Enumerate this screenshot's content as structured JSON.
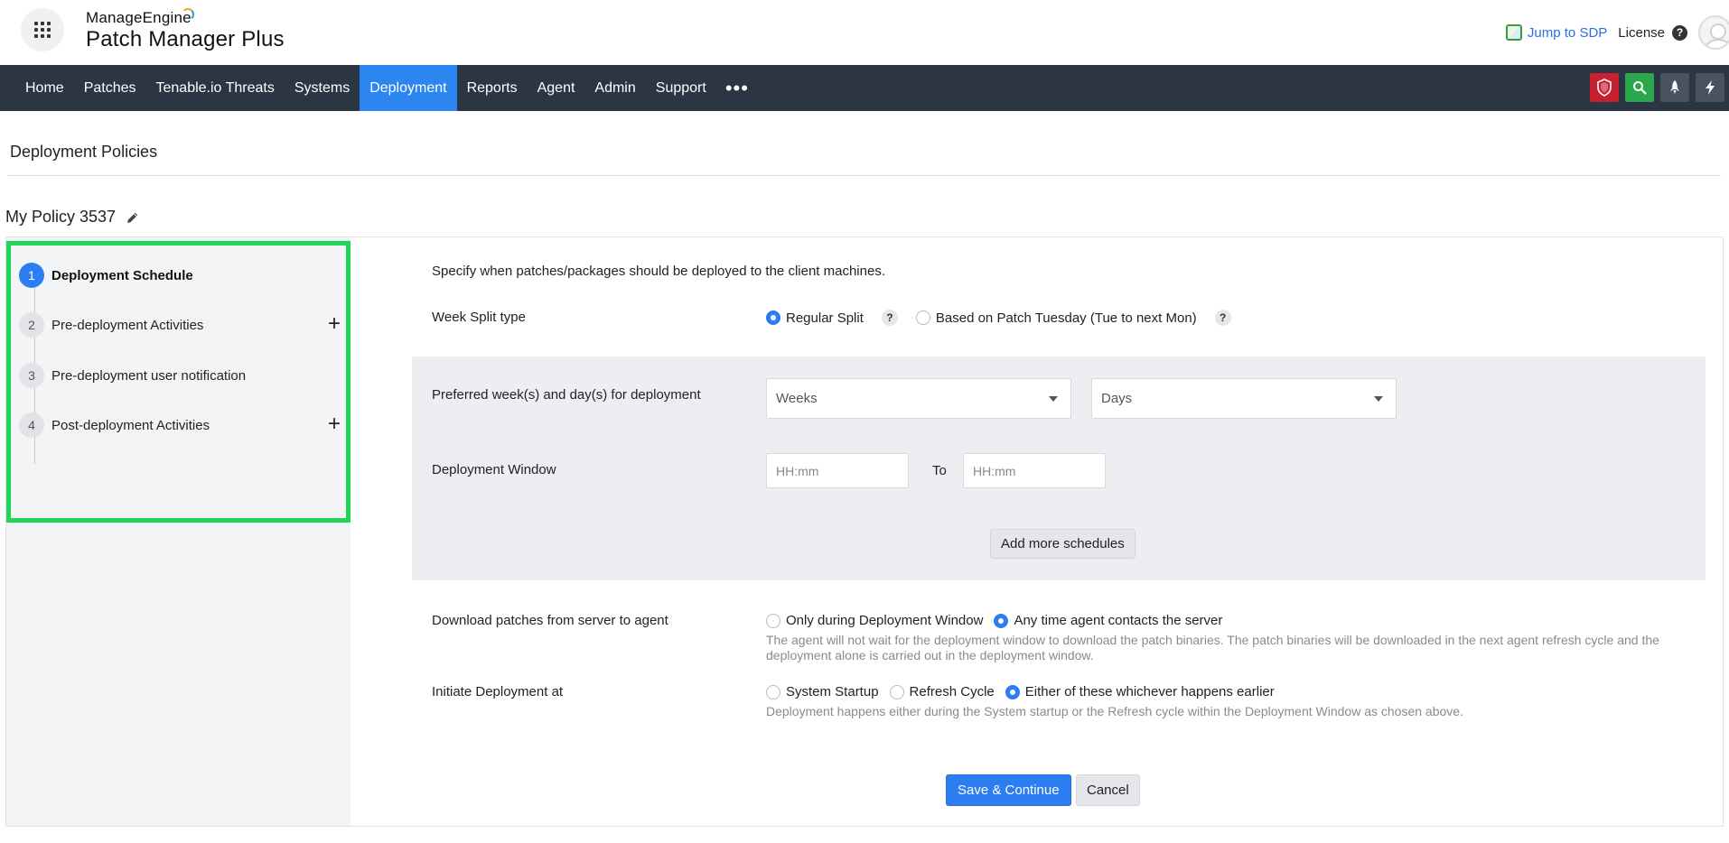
{
  "header": {
    "brand_small": "ManageEngine",
    "brand_product": "Patch Manager Plus",
    "jump_label": "Jump to SDP",
    "license_label": "License",
    "help_glyph": "?"
  },
  "nav": {
    "items": [
      {
        "label": "Home"
      },
      {
        "label": "Patches"
      },
      {
        "label": "Tenable.io Threats"
      },
      {
        "label": "Systems"
      },
      {
        "label": "Deployment",
        "active": true
      },
      {
        "label": "Reports"
      },
      {
        "label": "Agent"
      },
      {
        "label": "Admin"
      },
      {
        "label": "Support"
      }
    ],
    "more_glyph": "•••",
    "tools": [
      "shield-icon",
      "search-icon",
      "rocket-icon",
      "lightning-icon"
    ],
    "accent": "#2b86f1",
    "bar_color": "#2b3544"
  },
  "page": {
    "title": "Deployment Policies",
    "policy_name": "My Policy 3537"
  },
  "steps": [
    {
      "num": "1",
      "label": "Deployment Schedule",
      "active": true,
      "expandable": false
    },
    {
      "num": "2",
      "label": "Pre-deployment Activities",
      "active": false,
      "expandable": true
    },
    {
      "num": "3",
      "label": "Pre-deployment user notification",
      "active": false,
      "expandable": false
    },
    {
      "num": "4",
      "label": "Post-deployment Activities",
      "active": false,
      "expandable": true
    }
  ],
  "plus_glyph": "+",
  "form": {
    "intro": "Specify when patches/packages should be deployed to the client machines.",
    "week_split": {
      "label": "Week Split type",
      "options": [
        {
          "label": "Regular Split",
          "checked": true
        },
        {
          "label": "Based on Patch Tuesday (Tue to next Mon)",
          "checked": false
        }
      ],
      "help_glyph": "?"
    },
    "preferred": {
      "label": "Preferred week(s) and day(s) for deployment",
      "weeks_value": "Weeks",
      "days_value": "Days"
    },
    "window": {
      "label": "Deployment Window",
      "from_placeholder": "HH:mm",
      "to_label": "To",
      "to_placeholder": "HH:mm"
    },
    "add_schedules_label": "Add more schedules",
    "download": {
      "label": "Download patches from server to agent",
      "options": [
        {
          "label": "Only during Deployment Window",
          "checked": false
        },
        {
          "label": "Any time agent contacts the server",
          "checked": true
        }
      ],
      "hint": "The agent will not wait for the deployment window to download the patch binaries. The patch binaries will be downloaded in the next agent refresh cycle and the deployment alone is carried out in the deployment window."
    },
    "initiate": {
      "label": "Initiate Deployment at",
      "options": [
        {
          "label": "System Startup",
          "checked": false
        },
        {
          "label": "Refresh Cycle",
          "checked": false
        },
        {
          "label": "Either of these whichever happens earlier",
          "checked": true
        }
      ],
      "hint": "Deployment happens either during the System startup or the Refresh cycle within the Deployment Window as chosen above."
    },
    "save_label": "Save & Continue",
    "cancel_label": "Cancel"
  },
  "colors": {
    "step_highlight_border": "#1fd65a",
    "primary_button": "#2b7df1"
  }
}
